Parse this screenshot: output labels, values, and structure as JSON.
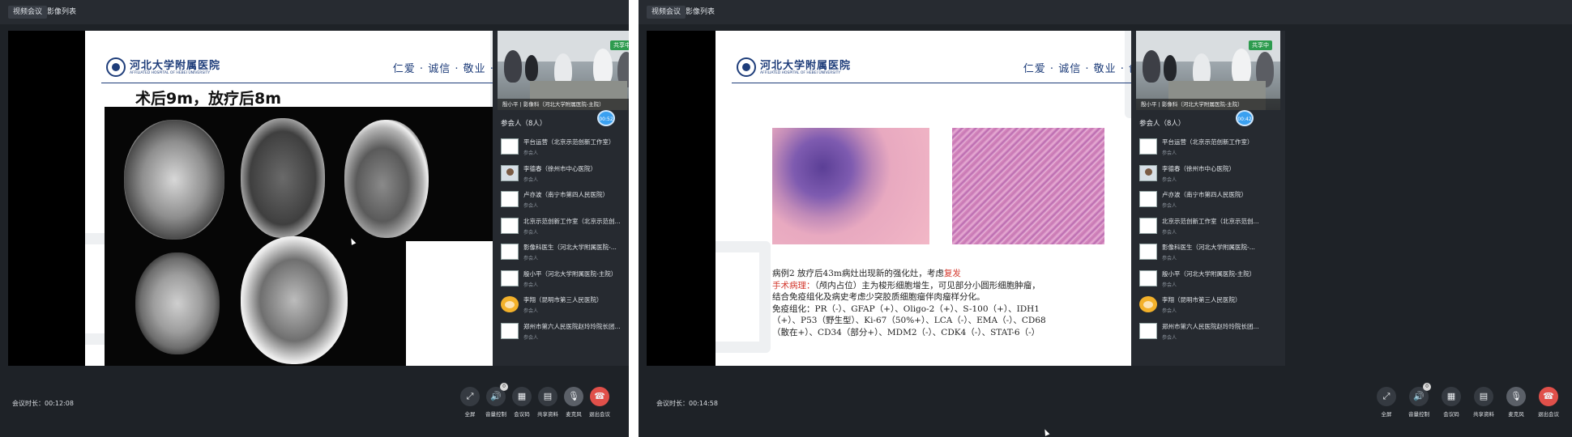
{
  "left": {
    "tabs": [
      "视频会议",
      "影像列表"
    ],
    "slide": {
      "hospital_cn": "河北大学附属医院",
      "hospital_en": "AFFILIATED HOSPITAL OF HEBEI UNIVERSITY",
      "motto": "仁爱 · 诚信 · 敬业 · 创新",
      "title": "术后9m，放疗后8m"
    },
    "camera": {
      "badge": "共享中",
      "label": "殷小平 | 影像科（河北大学附属医院-主院）",
      "time": "00:52"
    },
    "participants_title": "参会人（8人）",
    "duration": "会议时长：00:12:08"
  },
  "right": {
    "tabs": [
      "视频会议",
      "影像列表"
    ],
    "slide": {
      "hospital_cn": "河北大学附属医院",
      "hospital_en": "AFFILIATED HOSPITAL OF HEBEI UNIVERSITY",
      "motto": "仁爱 · 诚信 · 敬业 · 创新",
      "line1_a": "病例2 放疗后43m病灶出现新的强化灶，考虑",
      "line1_b": "复发",
      "line2_a": "手术病理：",
      "line2_b": "（颅内占位）主为梭形细胞增生，可见部分小圆形细胞肿瘤，",
      "line3": "结合免疫组化及病史考虑少突胶质细胞瘤伴肉瘤样分化。",
      "line4": "免疫组化：PR（-）、GFAP（+）、Oligo-2（+）、S-100（+）、IDH1",
      "line5": "（+）、P53（野生型）、Ki-67（50%+）、LCA（-）、EMA（-）、CD68",
      "line6": "（散在+）、CD34（部分+）、MDM2（-）、CDK4（-）、STAT-6（-）"
    },
    "camera": {
      "badge": "共享中",
      "label": "殷小平 | 影像科（河北大学附属医院-主院）",
      "time": "00:42"
    },
    "participants_title": "参会人（8人）",
    "duration": "会议时长：00:14:58"
  },
  "participants": [
    {
      "name": "平台运营（北京示范创新工作室）",
      "role": "参会人"
    },
    {
      "name": "李德春（徐州市中心医院）",
      "role": "参会人"
    },
    {
      "name": "卢亦波（南宁市第四人民医院）",
      "role": "参会人"
    },
    {
      "name": "北京示范创新工作室（北京示范创...",
      "role": "参会人"
    },
    {
      "name": "影像科医生（河北大学附属医院-...",
      "role": "参会人"
    },
    {
      "name": "殷小平（河北大学附属医院-主院）",
      "role": "参会人"
    },
    {
      "name": "李翔（昆明市第三人民医院）",
      "role": "参会人"
    },
    {
      "name": "郑州市第六人民医院赵玲玲院长团...",
      "role": "参会人"
    }
  ],
  "controls": [
    {
      "label": "全屏",
      "icon": "fullscreen-icon",
      "glyph": "⤢"
    },
    {
      "label": "音量控制",
      "icon": "volume-icon",
      "glyph": "🔊",
      "badge": "0"
    },
    {
      "label": "会议码",
      "icon": "qrcode-icon",
      "glyph": "▦"
    },
    {
      "label": "共享资料",
      "icon": "share-doc-icon",
      "glyph": "▤"
    },
    {
      "label": "麦克风",
      "icon": "microphone-icon",
      "glyph": "🎙"
    },
    {
      "label": "退出会议",
      "icon": "hangup-icon",
      "glyph": "☎"
    }
  ],
  "colors": {
    "brand_blue": "#1e3d7a",
    "hangup_red": "#e0504a",
    "share_green": "#2d9b4e",
    "highlight_red": "#d43a2f"
  }
}
